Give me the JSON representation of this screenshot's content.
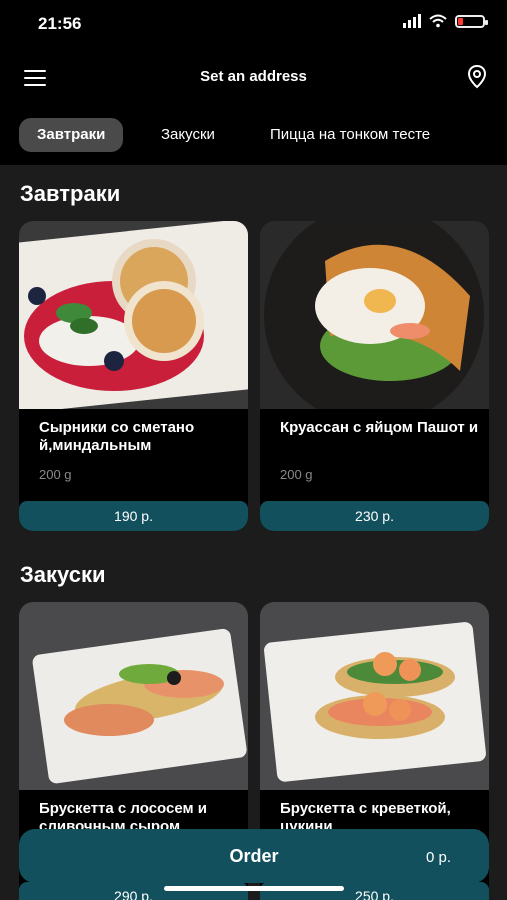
{
  "status_bar": {
    "time": "21:56"
  },
  "header": {
    "title": "Set an address"
  },
  "tabs": [
    {
      "label": "Завтраки"
    },
    {
      "label": "Закуски"
    },
    {
      "label": "Пицца на тонком тесте"
    }
  ],
  "sections": [
    {
      "title": "Завтраки",
      "items": [
        {
          "name": "Сырники со сметано й,миндальным",
          "weight": "200 g",
          "price": "190 р."
        },
        {
          "name": "Круассан с яйцом Пашот и",
          "weight": "200 g",
          "price": "230 р."
        }
      ]
    },
    {
      "title": "Закуски",
      "items": [
        {
          "name": "Брускетта с лососем и сливочным сыром",
          "price": "290 р."
        },
        {
          "name": "Брускетта с креветкой, цукини",
          "price": "250 р."
        }
      ]
    }
  ],
  "order": {
    "label": "Order",
    "total": "0 р."
  },
  "colors": {
    "accent": "#12505e",
    "background": "#1c1c1c",
    "header": "#000000",
    "active_tab": "#4a4a4a",
    "battery_low": "#ff3b30"
  }
}
